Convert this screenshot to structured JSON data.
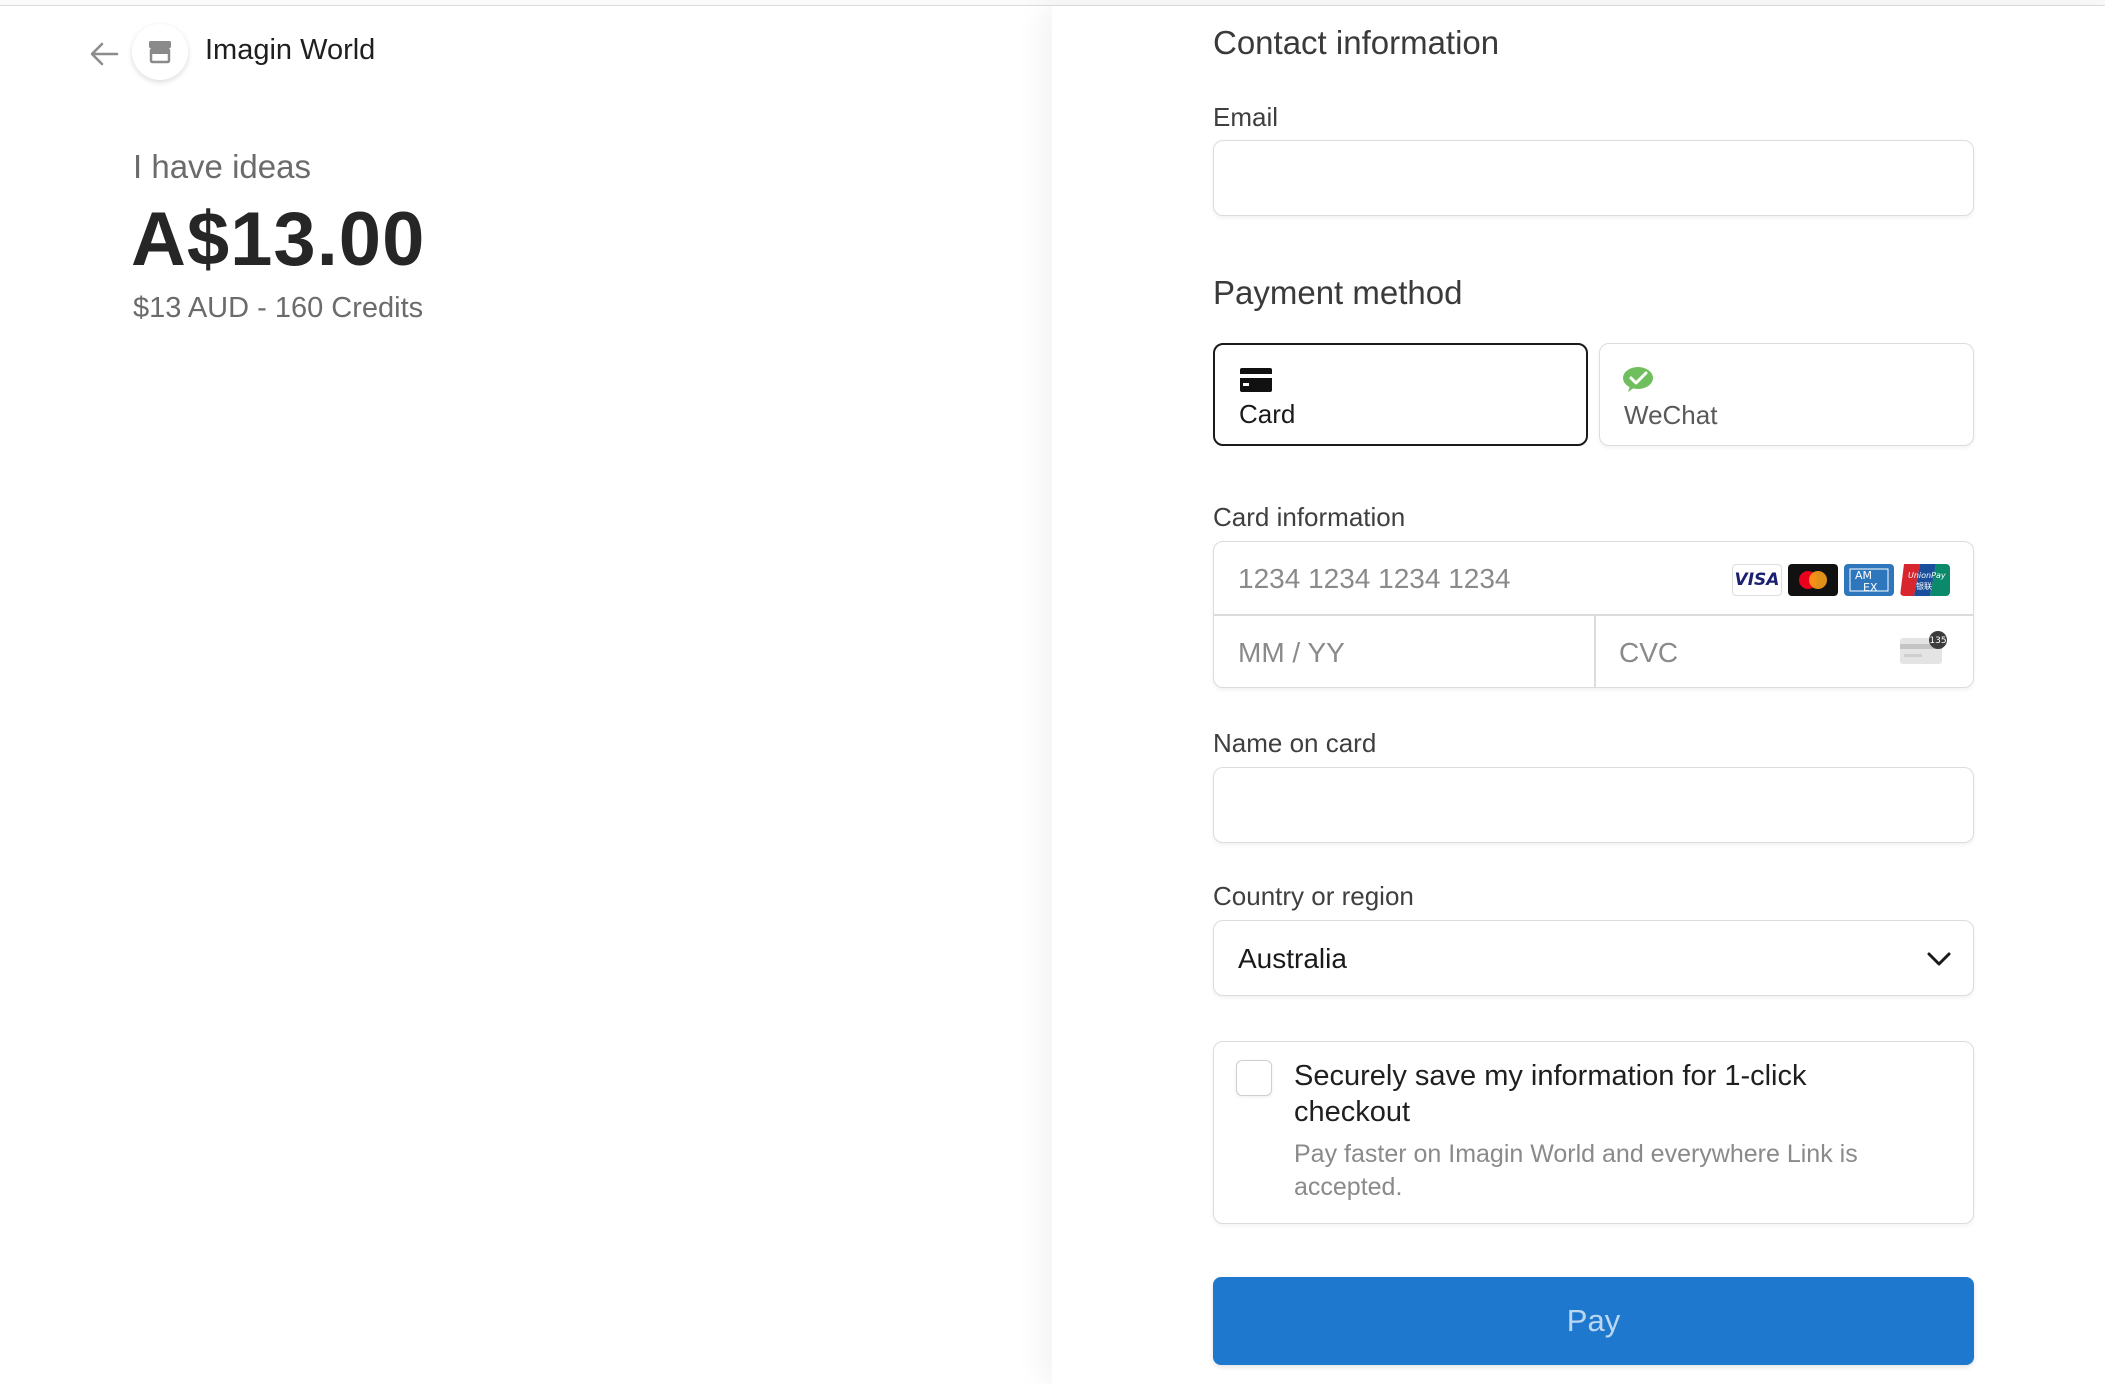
{
  "merchant": {
    "name": "Imagin World",
    "back_icon": "arrow-left-icon",
    "avatar_icon": "store-icon"
  },
  "product": {
    "name": "I have ideas",
    "price": "A$13.00",
    "description": "$13 AUD - 160 Credits"
  },
  "contact": {
    "title": "Contact information",
    "email_label": "Email",
    "email_value": ""
  },
  "payment": {
    "title": "Payment method",
    "methods": [
      {
        "label": "Card",
        "icon": "credit-card-icon",
        "selected": true
      },
      {
        "label": "WeChat",
        "icon": "wechat-icon",
        "selected": false
      }
    ]
  },
  "card": {
    "label": "Card information",
    "number_placeholder": "1234 1234 1234 1234",
    "expiry_placeholder": "MM / YY",
    "cvc_placeholder": "CVC",
    "brands": [
      "VISA",
      "Mastercard",
      "AMEX",
      "UnionPay"
    ],
    "cvc_hint": "135"
  },
  "name_on_card": {
    "label": "Name on card",
    "value": ""
  },
  "country": {
    "label": "Country or region",
    "value": "Australia"
  },
  "save_info": {
    "title": "Securely save my information for 1-click checkout",
    "description": "Pay faster on Imagin World and everywhere Link is accepted.",
    "checked": false
  },
  "pay_button": {
    "label": "Pay"
  },
  "colors": {
    "pay_button": "#1d78ce",
    "wechat_green": "#6fbf5f",
    "visa_blue": "#1a1f71",
    "amex_blue": "#2e77bc",
    "unionpay_red": "#d7262e"
  }
}
